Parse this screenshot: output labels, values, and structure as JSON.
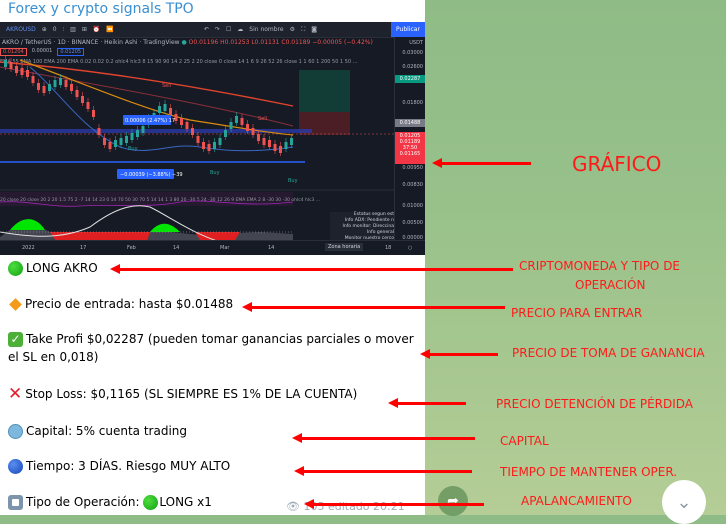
{
  "channel": {
    "title": "Forex y crypto signals TPO"
  },
  "chart": {
    "toolbar": {
      "symbol": "AKROUSD",
      "interval_count": "0",
      "layout_name": "Sin nombre",
      "publish_label": "Publicar"
    },
    "legend": {
      "title": "AKRO / TetherUS · 1D · BINANCE · Heikin Ashi · TradingView",
      "ohlc": "O0.01196 H0.01253 L0.01131 C0.01189 −0.00005 (−0.42%)",
      "badges": [
        "0.01204",
        "0.00001",
        "0.01205"
      ],
      "indicator_line": "EMA 55 EMA 100 EMA 200 EMA 0.02 0.02 0.2 ohlc4 hlc3 8 15 90 90 14 2 25 2 20 close 0 close 14 1 6 9 26 52 26 close 1 1 60 1 200 50 1 50 ...",
      "oscillator_line": "20 close 20 close 20 2 20 1.5 75 2 -7 14 14 23 0 14 70 50 30 70 5 14 14 1 3 80 20 -30 5 24 -30 12 26 9 EMA EMA 2 8 -30 30 -30 ohlc4 hlc3 ..."
    },
    "price_axis": {
      "currency": "USDT",
      "labels": [
        "0.03000",
        "0.02600",
        "0.01800",
        "0.00950",
        "0.00830",
        "0.01000",
        "0.00500",
        "0.00000"
      ],
      "take_profit": "0.02287",
      "entry": "0.01488",
      "current": [
        "0.01205",
        "0.01189",
        "37:50"
      ],
      "stop_loss": "0.01165"
    },
    "measure_labels": [
      "0.00006 (2.47%) 17",
      "−0.00039 (−3.88%) −39"
    ],
    "signals": [
      "Sell",
      "Buy",
      "Buy",
      "Buy",
      "Sell",
      "Buy"
    ],
    "time_axis": [
      "2022",
      "17",
      "Feb",
      "14",
      "Mar",
      "14",
      "18"
    ],
    "zone_label": "Zona horaria",
    "status_box": [
      "Estatus segun est",
      "Info ADX: Pendiente n",
      "Info monitor: Direccina",
      "Info general",
      "Monitor nuestro cerco"
    ]
  },
  "message": {
    "lines": [
      {
        "emoji": "green-circle",
        "text": "LONG AKRO"
      },
      {
        "emoji": "orange-diamond",
        "text": "Precio de entrada: hasta $0.01488"
      },
      {
        "emoji": "check-mark",
        "text": "Take Profi $0,02287 (pueden tomar ganancias parciales o mover el SL en 0,018)"
      },
      {
        "emoji": "cross-mark",
        "text": "Stop Loss: $0,1165 (SL SIEMPRE ES 1% DE LA CUENTA)"
      },
      {
        "emoji": "globe",
        "text": "Capital: 5% cuenta trading"
      },
      {
        "emoji": "blue-circle",
        "text": "Tiempo: 3 DÍAS. Riesgo MUY ALTO"
      },
      {
        "emoji": "stop-button",
        "text": "Tipo de Operación: ",
        "suffix": "LONG x1"
      }
    ],
    "views": "105",
    "edited": "editado 20:21"
  },
  "annotations": {
    "grafico": "GRÁFICO",
    "cripto_line1": "CRIPTOMONEDA Y TIPO DE",
    "cripto_line2": "OPERACIÓN",
    "entrada": "PRECIO PARA ENTRAR",
    "ganancia": "PRECIO DE TOMA DE GANANCIA",
    "perdida": "PRECIO DETENCIÓN DE PÉRDIDA",
    "capital": "CAPITAL",
    "tiempo": "TIEMPO DE MANTENER OPER.",
    "apalancamiento": "APALANCAMIENTO"
  },
  "colors": {
    "annotation_red": "#ff1a1a",
    "chart_bg": "#161a25",
    "publish_blue": "#2962ff",
    "take_profit": "#089981",
    "stop_loss": "#f23645",
    "channel_title": "#3a8fd0"
  }
}
